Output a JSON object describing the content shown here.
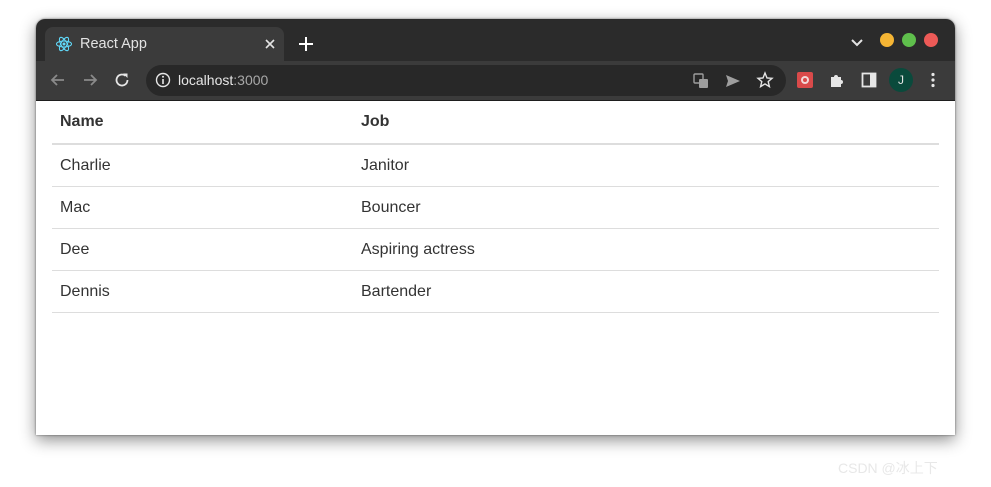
{
  "browser": {
    "tab": {
      "title": "React App",
      "favicon": "react-icon"
    },
    "address": {
      "host": "localhost",
      "port": ":3000"
    },
    "profile": {
      "initial": "J"
    },
    "colors": {
      "close": "#ed5a57",
      "minimize": "#f5b534",
      "maximize": "#5fbf4c"
    }
  },
  "table": {
    "headers": [
      "Name",
      "Job"
    ],
    "rows": [
      [
        "Charlie",
        "Janitor"
      ],
      [
        "Mac",
        "Bouncer"
      ],
      [
        "Dee",
        "Aspiring actress"
      ],
      [
        "Dennis",
        "Bartender"
      ]
    ]
  },
  "watermark": "CSDN @冰上下"
}
